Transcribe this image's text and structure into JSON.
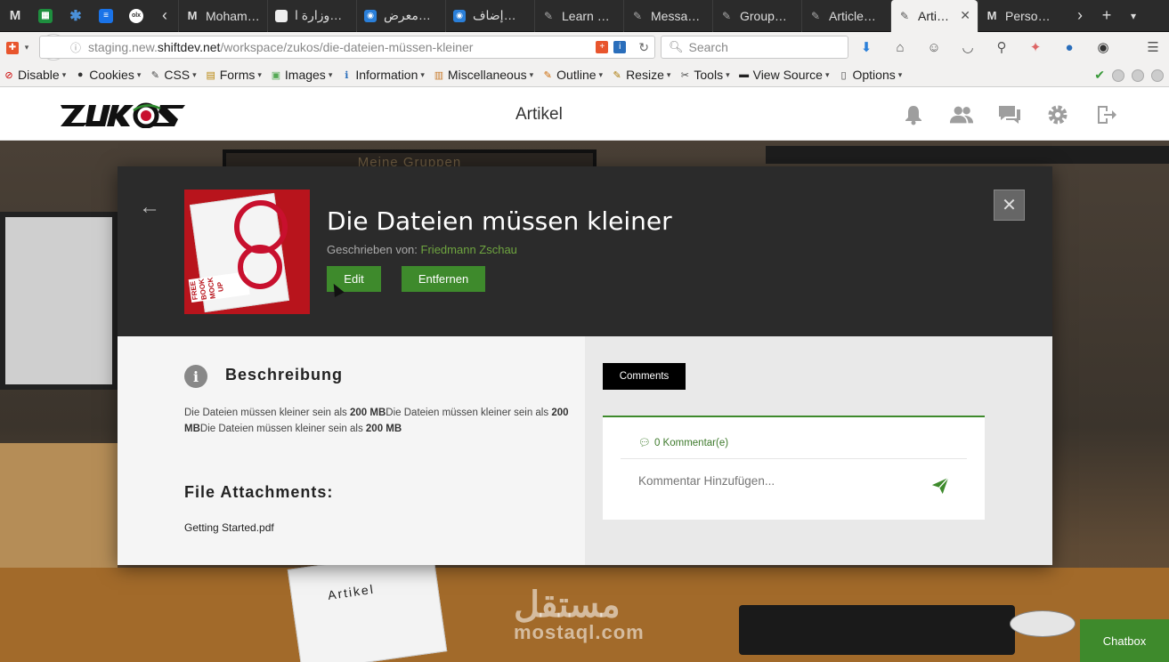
{
  "browser": {
    "tabs": [
      {
        "title": "Mohame…",
        "icon": "gmail-icon"
      },
      {
        "title": "وزارة ا…",
        "icon": "document-icon"
      },
      {
        "title": "معرض…",
        "icon": "mostaql-icon"
      },
      {
        "title": "إضاف…",
        "icon": "mostaql-icon"
      },
      {
        "title": "Learn …",
        "icon": "tools-icon"
      },
      {
        "title": "Messa…",
        "icon": "tools-icon"
      },
      {
        "title": "Group…",
        "icon": "tools-icon"
      },
      {
        "title": "Article…",
        "icon": "tools-icon"
      },
      {
        "title": "Arti…",
        "icon": "tools-icon",
        "active": true
      },
      {
        "title": "Perso…",
        "icon": "gmail-icon"
      }
    ],
    "url_prefix": "staging.new.",
    "url_host": "shiftdev.net",
    "url_path": "/workspace/zukos/die-dateien-müssen-kleiner",
    "search_placeholder": "Search",
    "newtab_label": "+"
  },
  "devtoolbar": {
    "items": [
      {
        "label": "Disable",
        "icon": "disable-icon"
      },
      {
        "label": "Cookies",
        "icon": "cookies-icon"
      },
      {
        "label": "CSS",
        "icon": "css-icon"
      },
      {
        "label": "Forms",
        "icon": "forms-icon"
      },
      {
        "label": "Images",
        "icon": "images-icon"
      },
      {
        "label": "Information",
        "icon": "information-icon"
      },
      {
        "label": "Miscellaneous",
        "icon": "miscellaneous-icon"
      },
      {
        "label": "Outline",
        "icon": "outline-icon"
      },
      {
        "label": "Resize",
        "icon": "resize-icon"
      },
      {
        "label": "Tools",
        "icon": "tools-icon"
      },
      {
        "label": "View Source",
        "icon": "view-source-icon"
      },
      {
        "label": "Options",
        "icon": "options-icon"
      }
    ]
  },
  "site": {
    "page_title": "Artikel",
    "header_icons": [
      "bell-icon",
      "users-icon",
      "chat-icon",
      "settings-icon",
      "logout-icon"
    ]
  },
  "background": {
    "board_text": "Meine Gruppen",
    "paper_text": "Artikel",
    "watermark_arabic": "مستقل",
    "watermark_latin": "mostaql.com"
  },
  "article": {
    "title": "Die Dateien müssen kleiner",
    "author_label": "Geschrieben von:",
    "author_name": "Friedmann Zschau",
    "edit_label": "Edit",
    "remove_label": "Entfernen",
    "description_heading": "Beschreibung",
    "description_parts": [
      {
        "text": "Die Dateien müssen kleiner sein als ",
        "bold": false
      },
      {
        "text": "200 MB",
        "bold": true
      },
      {
        "text": "Die Dateien müssen kleiner sein als ",
        "bold": false
      },
      {
        "text": "200 MB",
        "bold": true
      },
      {
        "text": "Die Dateien müssen kleiner sein als ",
        "bold": false
      },
      {
        "text": "200 MB",
        "bold": true
      }
    ],
    "attachments_heading": "File Attachments:",
    "attachments": [
      "Getting Started.pdf"
    ],
    "cover_text": "FREE BOOK MOCK UP"
  },
  "comments": {
    "tab_label": "Comments",
    "count_label": "0 Kommentar(e)",
    "input_placeholder": "Kommentar Hinzufügen..."
  },
  "chatbox": {
    "label": "Chatbox"
  },
  "colors": {
    "accent_green": "#3e8a2c",
    "modal_header": "#2b2b2b",
    "author_link": "#6fa540"
  }
}
